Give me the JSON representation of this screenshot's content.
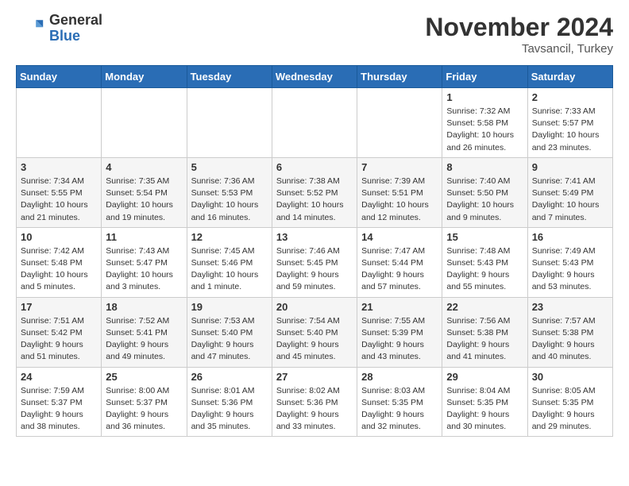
{
  "header": {
    "logo_general": "General",
    "logo_blue": "Blue",
    "month_title": "November 2024",
    "location": "Tavsancil, Turkey"
  },
  "weekdays": [
    "Sunday",
    "Monday",
    "Tuesday",
    "Wednesday",
    "Thursday",
    "Friday",
    "Saturday"
  ],
  "weeks": [
    [
      {
        "day": "",
        "info": ""
      },
      {
        "day": "",
        "info": ""
      },
      {
        "day": "",
        "info": ""
      },
      {
        "day": "",
        "info": ""
      },
      {
        "day": "",
        "info": ""
      },
      {
        "day": "1",
        "info": "Sunrise: 7:32 AM\nSunset: 5:58 PM\nDaylight: 10 hours\nand 26 minutes."
      },
      {
        "day": "2",
        "info": "Sunrise: 7:33 AM\nSunset: 5:57 PM\nDaylight: 10 hours\nand 23 minutes."
      }
    ],
    [
      {
        "day": "3",
        "info": "Sunrise: 7:34 AM\nSunset: 5:55 PM\nDaylight: 10 hours\nand 21 minutes."
      },
      {
        "day": "4",
        "info": "Sunrise: 7:35 AM\nSunset: 5:54 PM\nDaylight: 10 hours\nand 19 minutes."
      },
      {
        "day": "5",
        "info": "Sunrise: 7:36 AM\nSunset: 5:53 PM\nDaylight: 10 hours\nand 16 minutes."
      },
      {
        "day": "6",
        "info": "Sunrise: 7:38 AM\nSunset: 5:52 PM\nDaylight: 10 hours\nand 14 minutes."
      },
      {
        "day": "7",
        "info": "Sunrise: 7:39 AM\nSunset: 5:51 PM\nDaylight: 10 hours\nand 12 minutes."
      },
      {
        "day": "8",
        "info": "Sunrise: 7:40 AM\nSunset: 5:50 PM\nDaylight: 10 hours\nand 9 minutes."
      },
      {
        "day": "9",
        "info": "Sunrise: 7:41 AM\nSunset: 5:49 PM\nDaylight: 10 hours\nand 7 minutes."
      }
    ],
    [
      {
        "day": "10",
        "info": "Sunrise: 7:42 AM\nSunset: 5:48 PM\nDaylight: 10 hours\nand 5 minutes."
      },
      {
        "day": "11",
        "info": "Sunrise: 7:43 AM\nSunset: 5:47 PM\nDaylight: 10 hours\nand 3 minutes."
      },
      {
        "day": "12",
        "info": "Sunrise: 7:45 AM\nSunset: 5:46 PM\nDaylight: 10 hours\nand 1 minute."
      },
      {
        "day": "13",
        "info": "Sunrise: 7:46 AM\nSunset: 5:45 PM\nDaylight: 9 hours\nand 59 minutes."
      },
      {
        "day": "14",
        "info": "Sunrise: 7:47 AM\nSunset: 5:44 PM\nDaylight: 9 hours\nand 57 minutes."
      },
      {
        "day": "15",
        "info": "Sunrise: 7:48 AM\nSunset: 5:43 PM\nDaylight: 9 hours\nand 55 minutes."
      },
      {
        "day": "16",
        "info": "Sunrise: 7:49 AM\nSunset: 5:43 PM\nDaylight: 9 hours\nand 53 minutes."
      }
    ],
    [
      {
        "day": "17",
        "info": "Sunrise: 7:51 AM\nSunset: 5:42 PM\nDaylight: 9 hours\nand 51 minutes."
      },
      {
        "day": "18",
        "info": "Sunrise: 7:52 AM\nSunset: 5:41 PM\nDaylight: 9 hours\nand 49 minutes."
      },
      {
        "day": "19",
        "info": "Sunrise: 7:53 AM\nSunset: 5:40 PM\nDaylight: 9 hours\nand 47 minutes."
      },
      {
        "day": "20",
        "info": "Sunrise: 7:54 AM\nSunset: 5:40 PM\nDaylight: 9 hours\nand 45 minutes."
      },
      {
        "day": "21",
        "info": "Sunrise: 7:55 AM\nSunset: 5:39 PM\nDaylight: 9 hours\nand 43 minutes."
      },
      {
        "day": "22",
        "info": "Sunrise: 7:56 AM\nSunset: 5:38 PM\nDaylight: 9 hours\nand 41 minutes."
      },
      {
        "day": "23",
        "info": "Sunrise: 7:57 AM\nSunset: 5:38 PM\nDaylight: 9 hours\nand 40 minutes."
      }
    ],
    [
      {
        "day": "24",
        "info": "Sunrise: 7:59 AM\nSunset: 5:37 PM\nDaylight: 9 hours\nand 38 minutes."
      },
      {
        "day": "25",
        "info": "Sunrise: 8:00 AM\nSunset: 5:37 PM\nDaylight: 9 hours\nand 36 minutes."
      },
      {
        "day": "26",
        "info": "Sunrise: 8:01 AM\nSunset: 5:36 PM\nDaylight: 9 hours\nand 35 minutes."
      },
      {
        "day": "27",
        "info": "Sunrise: 8:02 AM\nSunset: 5:36 PM\nDaylight: 9 hours\nand 33 minutes."
      },
      {
        "day": "28",
        "info": "Sunrise: 8:03 AM\nSunset: 5:35 PM\nDaylight: 9 hours\nand 32 minutes."
      },
      {
        "day": "29",
        "info": "Sunrise: 8:04 AM\nSunset: 5:35 PM\nDaylight: 9 hours\nand 30 minutes."
      },
      {
        "day": "30",
        "info": "Sunrise: 8:05 AM\nSunset: 5:35 PM\nDaylight: 9 hours\nand 29 minutes."
      }
    ]
  ]
}
